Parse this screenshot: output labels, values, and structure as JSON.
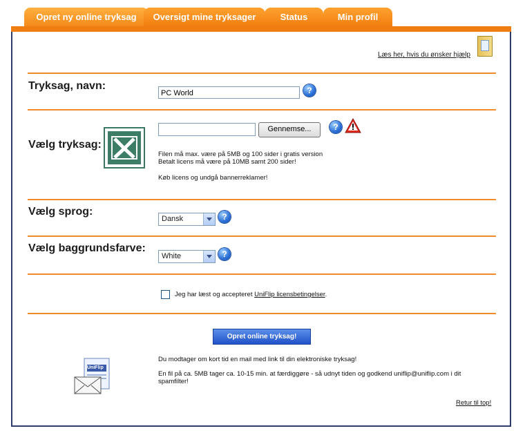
{
  "tabs": [
    {
      "label": "Opret ny online tryksag",
      "active": true
    },
    {
      "label": "Oversigt mine tryksager",
      "active": false
    },
    {
      "label": "Status",
      "active": false
    },
    {
      "label": "Min profil",
      "active": false
    }
  ],
  "help_link": "Læs her, hvis du ønsker hjælp",
  "name_row": {
    "label": "Tryksag, navn:",
    "value": "PC World"
  },
  "file_row": {
    "label": "Vælg tryksag:",
    "browse_label": "Gennemse...",
    "file_value": "",
    "note_line1": "Filen må max. være på 5MB og 100 sider i gratis version",
    "note_line2": "Betalt licens må være på 10MB samt 200 sider!",
    "note_line3": "Køb licens og undgå bannerreklamer!"
  },
  "language_row": {
    "label": "Vælg sprog:",
    "selected": "Dansk"
  },
  "bgcolor_row": {
    "label": "Vælg baggrundsfarve:",
    "selected": "White"
  },
  "terms": {
    "prefix": "Jeg har læst og accepteret ",
    "link": "UniFlip licensbetingelser",
    "suffix": ".",
    "checked": false
  },
  "submit_label": "Opret online tryksag!",
  "info_line1": "Du modtager om kort tid en mail med link til din elektroniske tryksag!",
  "info_line2": "En fil på ca. 5MB tager ca. 10-15 min. at færdiggøre - så udnyt tiden og godkend uniflip@uniflip.com i dit",
  "info_line3": "spamfilter!",
  "envelope_brand": "UniFlip",
  "back_to_top": "Retur til top!",
  "colors": {
    "accent": "#f07d12",
    "border": "#2d3a6c",
    "link_blue": "#2152c9"
  }
}
